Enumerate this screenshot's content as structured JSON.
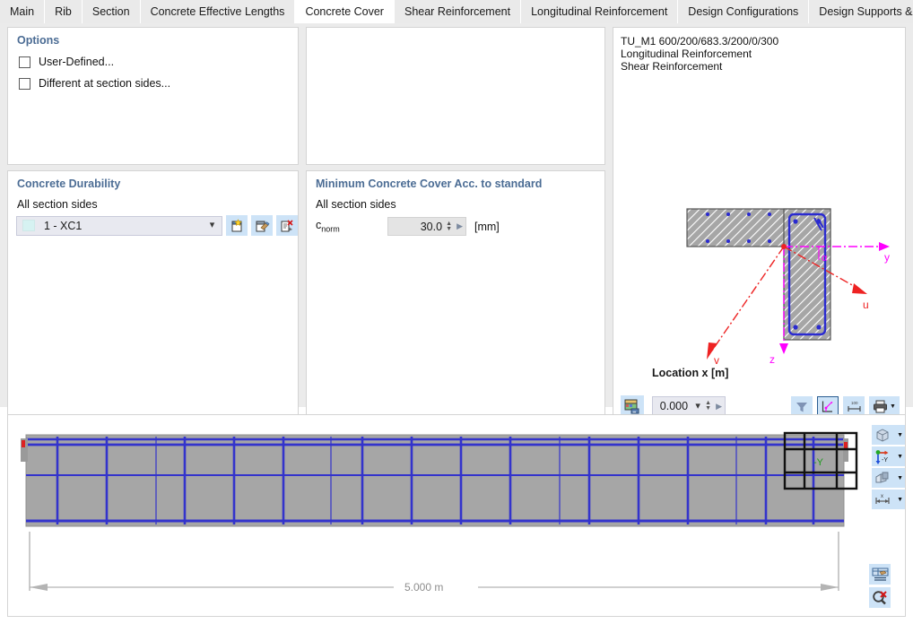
{
  "tabs": [
    {
      "label": "Main",
      "active": false
    },
    {
      "label": "Rib",
      "active": false
    },
    {
      "label": "Section",
      "active": false
    },
    {
      "label": "Concrete Effective Lengths",
      "active": false
    },
    {
      "label": "Concrete Cover",
      "active": true
    },
    {
      "label": "Shear Reinforcement",
      "active": false
    },
    {
      "label": "Longitudinal Reinforcement",
      "active": false
    },
    {
      "label": "Design Configurations",
      "active": false
    },
    {
      "label": "Design Supports & Deflection",
      "active": false
    }
  ],
  "options_panel": {
    "title": "Options",
    "checkbox_user_defined": {
      "label": "User-Defined...",
      "checked": false
    },
    "checkbox_different_sides": {
      "label": "Different at section sides...",
      "checked": false
    }
  },
  "durability_panel": {
    "title": "Concrete Durability",
    "subtitle": "All section sides",
    "combo_value": "1 - XC1",
    "combo_swatch_color": "#d6f2f2",
    "buttons": [
      {
        "name": "new-exposure-class-button",
        "icon": "new-document-icon"
      },
      {
        "name": "edit-exposure-class-button",
        "icon": "edit-document-icon"
      },
      {
        "name": "delete-exposure-class-button",
        "icon": "delete-document-icon"
      }
    ]
  },
  "cover_panel": {
    "title": "Minimum Concrete Cover Acc. to standard",
    "subtitle": "All section sides",
    "field_label_base": "c",
    "field_label_sub": "norm",
    "field_value": "30.0",
    "field_unit": "[mm]"
  },
  "section_view": {
    "info_lines": [
      "TU_M1 600/200/683.3/200/0/300",
      "Longitudinal Reinforcement",
      "Shear Reinforcement"
    ],
    "axis_labels": {
      "y": "y",
      "z": "z",
      "u": "u",
      "v": "v",
      "angle": "α"
    },
    "location_label": "Location x [m]",
    "location_value": "0.000",
    "toolbar_buttons": [
      {
        "name": "render-image-button",
        "icon": "image-render-icon"
      },
      {
        "name": "filter-button",
        "icon": "filter-funnel-icon"
      },
      {
        "name": "show-axes-button",
        "icon": "section-axes-icon",
        "active": true
      },
      {
        "name": "dimensions-button",
        "icon": "dimension-icon"
      },
      {
        "name": "print-button",
        "icon": "printer-icon"
      }
    ]
  },
  "beam_view": {
    "dimension_label": "5.000 m",
    "section_marker_label": "-Y",
    "view_buttons": [
      {
        "name": "view-mode-button",
        "icon": "cube-icon"
      },
      {
        "name": "view-direction-button",
        "icon": "axis-tripod-icon",
        "label": "-Y"
      },
      {
        "name": "render-mode-button",
        "icon": "shaded-box-icon"
      },
      {
        "name": "dimension-mode-button",
        "icon": "measure-icon"
      }
    ],
    "corner_buttons": [
      {
        "name": "results-table-button",
        "icon": "table-results-icon"
      },
      {
        "name": "clear-selection-button",
        "icon": "magnifier-clear-icon"
      }
    ]
  },
  "colors": {
    "group_title": "#4b6c94",
    "rebar_blue": "#3333cc",
    "axis_magenta": "#ff00ff",
    "axis_red": "#ee2222",
    "concrete_gray": "#a6a6a6",
    "button_blue": "#cde3f7"
  }
}
